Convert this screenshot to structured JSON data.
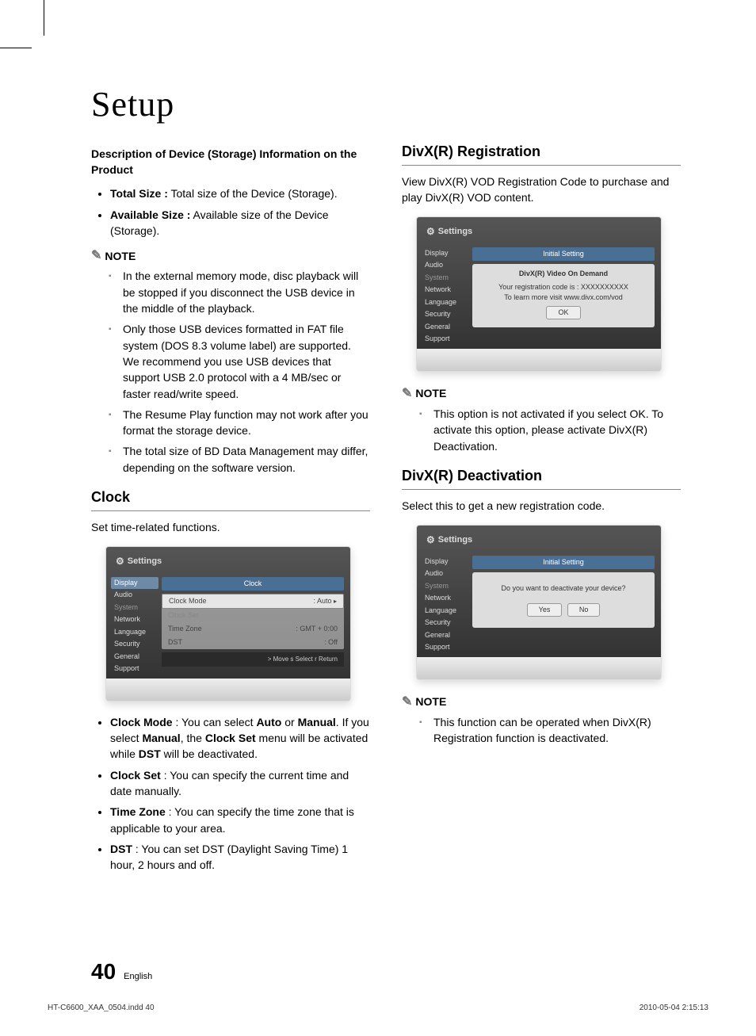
{
  "page_title": "Setup",
  "col1": {
    "storage_heading": "Description of Device (Storage) Information on the Product",
    "storage_bullets": [
      {
        "label": "Total Size :",
        "text": " Total size of the Device (Storage)."
      },
      {
        "label": "Available Size :",
        "text": " Available size of the Device (Storage)."
      }
    ],
    "note_label": "NOTE",
    "storage_notes": [
      "In the external memory mode, disc playback will be stopped if you disconnect the USB device in the middle of the playback.",
      "Only those USB  devices formatted in FAT file system (DOS 8.3 volume label) are supported. We recommend you use USB devices that support USB 2.0 protocol with a 4 MB/sec or faster read/write speed.",
      "The Resume Play function may not work after you format the storage device.",
      "The total size of BD Data Management may differ, depending on the software version."
    ],
    "clock_heading": "Clock",
    "clock_intro": "Set time-related functions.",
    "clock_ui": {
      "title": "Settings",
      "sidebar": [
        "Display",
        "Audio",
        "System",
        "Network",
        "Language",
        "Security",
        "General",
        "Support"
      ],
      "selected": "Display",
      "main_header": "Clock",
      "rows": [
        {
          "label": "Clock Mode",
          "value": ": Auto",
          "sel": true,
          "arrow": "▸"
        },
        {
          "label": "Clock Set",
          "value": "",
          "dim": true
        },
        {
          "label": "Time Zone",
          "value": ": GMT + 0:00"
        },
        {
          "label": "DST",
          "value": ": Off"
        }
      ],
      "footer": "> Move    s Select    r Return"
    },
    "clock_bullets": [
      {
        "html": "<b>Clock Mode</b> : You can select <b>Auto</b> or <b>Manual</b>. If you select <b>Manual</b>, the <b>Clock Set</b> menu will be activated while <b>DST</b> will be deactivated."
      },
      {
        "html": "<b>Clock Set</b> : You can specify the current time and date manually."
      },
      {
        "html": "<b>Time Zone</b> : You can specify the time zone that is applicable to your area."
      },
      {
        "html": "<b>DST</b> : You can set DST (Daylight Saving Time) 1 hour, 2 hours and off."
      }
    ]
  },
  "col2": {
    "divx_reg_heading": "DivX(R) Registration",
    "divx_reg_intro": "View DivX(R) VOD Registration Code to purchase and play DivX(R) VOD content.",
    "divx_reg_ui": {
      "title": "Settings",
      "sidebar": [
        "Display",
        "Audio",
        "System",
        "Network",
        "Language",
        "Security",
        "General",
        "Support"
      ],
      "main_header": "Initial Setting",
      "dialog_title": "DivX(R) Video On Demand",
      "dialog_l1": "Your registration code is : XXXXXXXXXX",
      "dialog_l2": "To learn more visit www.divx.com/vod",
      "ok": "OK"
    },
    "divx_reg_note_label": "NOTE",
    "divx_reg_notes": [
      "This option is not activated if you select OK. To activate this option, please activate DivX(R) Deactivation."
    ],
    "divx_deact_heading": "DivX(R) Deactivation",
    "divx_deact_intro": "Select this to get a new registration code.",
    "divx_deact_ui": {
      "title": "Settings",
      "sidebar": [
        "Display",
        "Audio",
        "System",
        "Network",
        "Language",
        "Security",
        "General",
        "Support"
      ],
      "main_header": "Initial Setting",
      "dialog_msg": "Do you want to deactivate your device?",
      "yes": "Yes",
      "no": "No"
    },
    "divx_deact_note_label": "NOTE",
    "divx_deact_notes": [
      "This function can be operated when DivX(R) Registration function is deactivated."
    ]
  },
  "footer": {
    "page_no": "40",
    "lang": "English",
    "indd": "HT-C6600_XAA_0504.indd   40",
    "timestamp": "2010-05-04    2:15:13"
  }
}
